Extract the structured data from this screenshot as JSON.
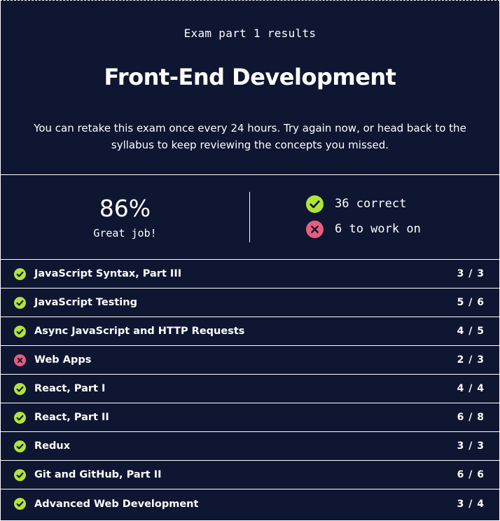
{
  "header": {
    "eyebrow": "Exam part 1 results",
    "title": "Front-End Development",
    "description": "You can retake this exam once every 24 hours. Try again now, or head back to the syllabus to keep reviewing the concepts you missed."
  },
  "summary": {
    "score": "86%",
    "message": "Great job!",
    "correct_label": "36 correct",
    "work_on_label": "6 to work on"
  },
  "colors": {
    "pass": "#b3e33b",
    "fail": "#e85d7f",
    "background": "#0f1631"
  },
  "topics": [
    {
      "name": "JavaScript Syntax, Part III",
      "score": "3 / 3",
      "status": "pass",
      "icon": "check-circle-icon"
    },
    {
      "name": "JavaScript Testing",
      "score": "5 / 6",
      "status": "pass",
      "icon": "check-circle-icon"
    },
    {
      "name": "Async JavaScript and HTTP Requests",
      "score": "4 / 5",
      "status": "pass",
      "icon": "check-circle-icon"
    },
    {
      "name": "Web Apps",
      "score": "2 / 3",
      "status": "fail",
      "icon": "x-circle-icon"
    },
    {
      "name": "React, Part I",
      "score": "4 / 4",
      "status": "pass",
      "icon": "check-circle-icon"
    },
    {
      "name": "React, Part II",
      "score": "6 / 8",
      "status": "pass",
      "icon": "check-circle-icon"
    },
    {
      "name": "Redux",
      "score": "3 / 3",
      "status": "pass",
      "icon": "check-circle-icon"
    },
    {
      "name": "Git and GitHub, Part II",
      "score": "6 / 6",
      "status": "pass",
      "icon": "check-circle-icon"
    },
    {
      "name": "Advanced Web Development",
      "score": "3 / 4",
      "status": "pass",
      "icon": "check-circle-icon"
    }
  ]
}
